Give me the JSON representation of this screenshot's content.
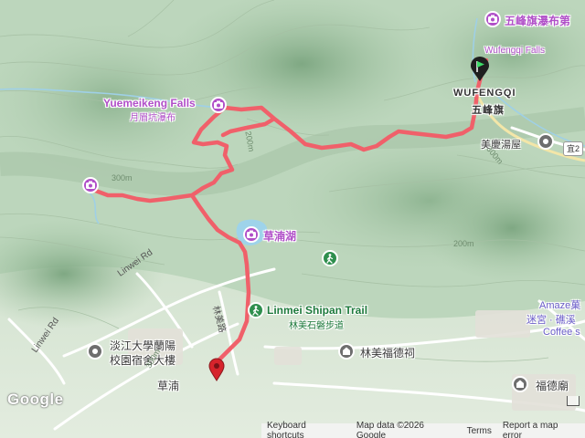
{
  "map": {
    "colors": {
      "route": "#f0606a",
      "poi_purple": "#b04fc8",
      "poi_green": "#1e7a3c"
    },
    "labels": {
      "wufengqi_falls": "五峰旗瀑布第",
      "wufengqi_falls_en": "Wufengqi Falls",
      "wufengqi_town_en": "WUFENGQI",
      "wufengqi_town_zh": "五峰旗",
      "yuemeikeng_falls_en": "Yuemeikeng Falls",
      "yuemeikeng_falls_zh": "月眉坑瀑布",
      "meiqing_hot_spring": "美慶湯屋",
      "caodi_lake": "草湳湖",
      "linmei_trail_en": "Linmei Shipan Trail",
      "linmei_trail_zh": "林美石磐步道",
      "linmei_temple": "林美福德祠",
      "tamkang_dorm_line1": "淡江大學蘭陽",
      "tamkang_dorm_line2": "校園宿舍大樓",
      "linwei_rd_1": "Linwei Rd",
      "linwei_rd_2": "Linwei Rd",
      "linmei_road_vert": "林美路",
      "caonan": "草湳",
      "fude_temple": "福德廟",
      "amaze_line1": "Amaze菓",
      "amaze_line2": "迷宮 · 礁溪",
      "amaze_line3": "Coffee s",
      "route_badge": "宜2",
      "elev_300_a": "300m",
      "elev_200_a": "200m",
      "elev_300_b": "300m",
      "elev_200_b": "200m",
      "elev_300_c": "300m"
    },
    "icons": [
      "camera-icon",
      "person-hiking-icon",
      "mosque-dome-icon",
      "start-flag-icon",
      "end-marker-icon"
    ],
    "attribution": {
      "keyboard": "Keyboard shortcuts",
      "data": "Map data ©2026 Google",
      "terms": "Terms",
      "report": "Report a map error"
    },
    "logo": "Google"
  }
}
